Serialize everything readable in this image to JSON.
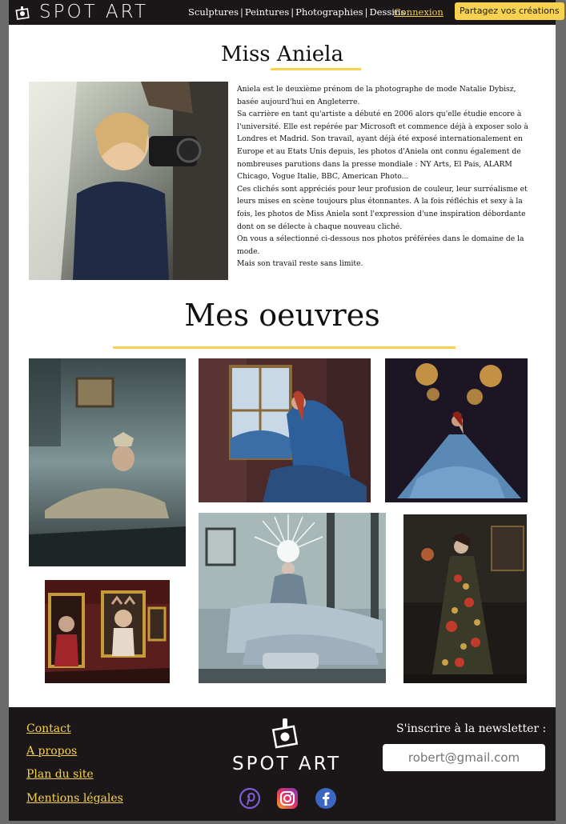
{
  "header": {
    "logo_text": "SPOT ART",
    "nav": [
      "Sculptures",
      "Peintures",
      "Photographies",
      "Dessins"
    ],
    "nav_separator": "|",
    "login": "Connexion",
    "share_button": "Partagez vos créations"
  },
  "artist": {
    "name": "Miss Aniela",
    "bio": [
      "Aniela est le deuxième prénom de la photographe de mode Natalie Dybisz, basée aujourd'hui en Angleterre.",
      "Sa carrière en tant qu'artiste a débuté en 2006 alors qu'elle étudie encore à l'université. Elle est repérée par Microsoft et commence déjà à exposer solo à Londres et Madrid. Son travail, ayant déjà été exposé internationalement en Europe et au Etats Unis depuis, les photos d'Aniela ont connu également de nombreuses parutions dans la presse mondiale : NY Arts, El Pais, ALARM Chicago, Vogue Italie, BBC, American Photo...",
      "Ces clichés sont appréciés pour leur profusion de couleur, leur surréalisme et leurs mises en scène toujours plus étonnantes. A la fois réfléchis et sexy à la fois, les photos de Miss Aniela sont l'expression d'une inspiration débordante dont on se délecte à chaque nouveau cliché.",
      "On vous a sélectionné ci-dessous nos photos préférées dans le domaine de la mode.",
      "Mais son travail reste sans limite."
    ]
  },
  "works": {
    "title": "Mes oeuvres"
  },
  "footer": {
    "links": [
      "Contact",
      "A propos",
      "Plan du site",
      "Mentions légales"
    ],
    "logo_text": "SPOT ART",
    "newsletter_label": "S'inscrire à la newsletter :",
    "newsletter_placeholder": "robert@gmail.com"
  },
  "colors": {
    "accent": "#f6d24f",
    "dark": "#1b1718"
  }
}
